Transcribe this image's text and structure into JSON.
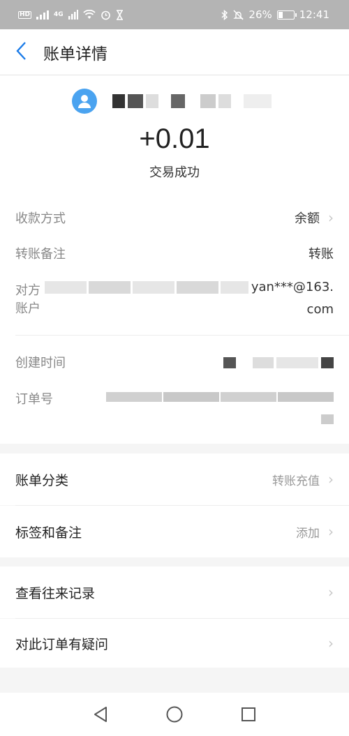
{
  "status_bar": {
    "hd_label": "HD",
    "net_label": "4G",
    "battery_percent": "26%",
    "battery_level": 0.26,
    "time": "12:41"
  },
  "header": {
    "title": "账单详情"
  },
  "summary": {
    "amount": "+0.01",
    "status": "交易成功"
  },
  "details": {
    "payment_method": {
      "label": "收款方式",
      "value": "余额"
    },
    "transfer_note": {
      "label": "转账备注",
      "value": "转账"
    },
    "counterparty": {
      "label": "对方账户",
      "value_line1": "yan***@163.",
      "value_line2": "com"
    },
    "created_time": {
      "label": "创建时间"
    },
    "order_no": {
      "label": "订单号"
    }
  },
  "bill_options": [
    {
      "label": "账单分类",
      "value": "转账充值"
    },
    {
      "label": "标签和备注",
      "value": "添加"
    }
  ],
  "actions": [
    {
      "label": "查看往来记录"
    },
    {
      "label": "对此订单有疑问"
    }
  ],
  "icons": {
    "back": "chevron-left-icon",
    "avatar": "user-avatar-icon",
    "arrow": "chevron-right-icon",
    "nav_back": "triangle-back-icon",
    "nav_home": "circle-home-icon",
    "nav_recent": "square-recent-icon"
  },
  "colors": {
    "accent": "#4aa3f0",
    "status_bar": "#b4b4b4",
    "background": "#f5f5f5"
  }
}
